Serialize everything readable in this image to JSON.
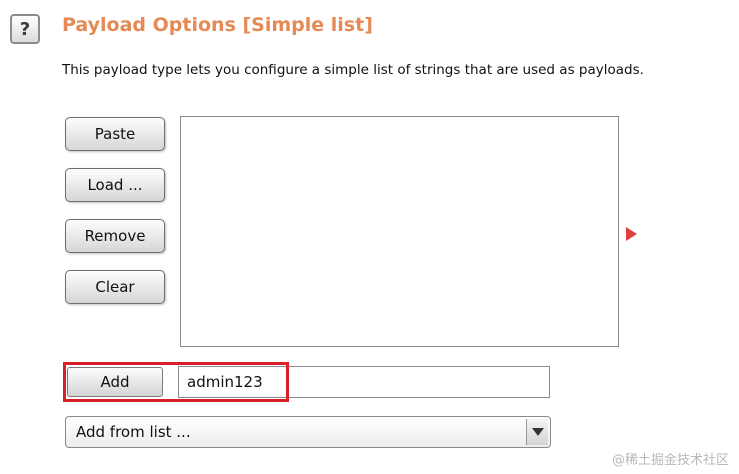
{
  "header": {
    "help_glyph": "?",
    "title": "Payload Options [Simple list]",
    "description": "This payload type lets you configure a simple list of strings that are used as payloads."
  },
  "buttons": {
    "paste": "Paste",
    "load": "Load ...",
    "remove": "Remove",
    "clear": "Clear",
    "add": "Add"
  },
  "add_field": {
    "value": "admin123"
  },
  "add_from_list": {
    "selected": "Add from list ..."
  },
  "watermark": "@稀土掘金技术社区",
  "colors": {
    "title": "#e58a55",
    "highlight": "#d9202a",
    "arrow": "#e0403a"
  },
  "icons": {
    "help": "help-icon",
    "side_arrow": "triangle-right-icon",
    "dropdown": "chevron-down-icon"
  }
}
